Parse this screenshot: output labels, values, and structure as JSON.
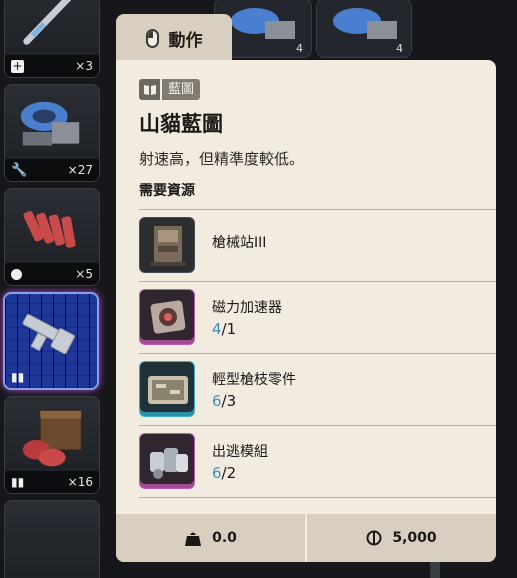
{
  "inventory": [
    {
      "type_icon": "plus-icon",
      "count": "×3"
    },
    {
      "type_icon": "wrench-icon",
      "count": "×27"
    },
    {
      "type_icon": "grenade-icon",
      "count": "×5"
    },
    {
      "type_icon": "blueprint-icon",
      "count": ""
    },
    {
      "type_icon": "ammo-icon",
      "count": "×16"
    }
  ],
  "right_column_partial": [
    "4",
    "4"
  ],
  "tooltip": {
    "tab_label": "動作",
    "tab_icon": "mouse-icon",
    "category_label": "藍圖",
    "category_icon": "blueprint-book-icon",
    "title": "山貓藍圖",
    "description": "射速高，但精準度較低。",
    "requirements_header": "需要資源",
    "requirements": [
      {
        "name": "槍械站III",
        "have": "",
        "need": "",
        "rarity": "common",
        "icon": "gun-workbench-icon"
      },
      {
        "name": "磁力加速器",
        "have": "4",
        "need": "/1",
        "rarity": "epic",
        "icon": "magnetic-accelerator-icon"
      },
      {
        "name": "輕型槍枝零件",
        "have": "6",
        "need": "/3",
        "rarity": "rare",
        "icon": "light-gun-parts-icon"
      },
      {
        "name": "出逃模組",
        "have": "6",
        "need": "/2",
        "rarity": "epic",
        "icon": "escape-module-icon"
      }
    ],
    "weight": "0.0",
    "weight_icon": "weight-icon",
    "price": "5,000",
    "price_icon": "coin-icon"
  },
  "colors": {
    "panel_bg": "#f2ebe0",
    "tab_bg": "#d9cfc0",
    "have_count": "#3e8fb5",
    "epic_border": "#c05cb0",
    "rare_border": "#3fb0c8",
    "selected_slot": "#8a9fe8"
  }
}
